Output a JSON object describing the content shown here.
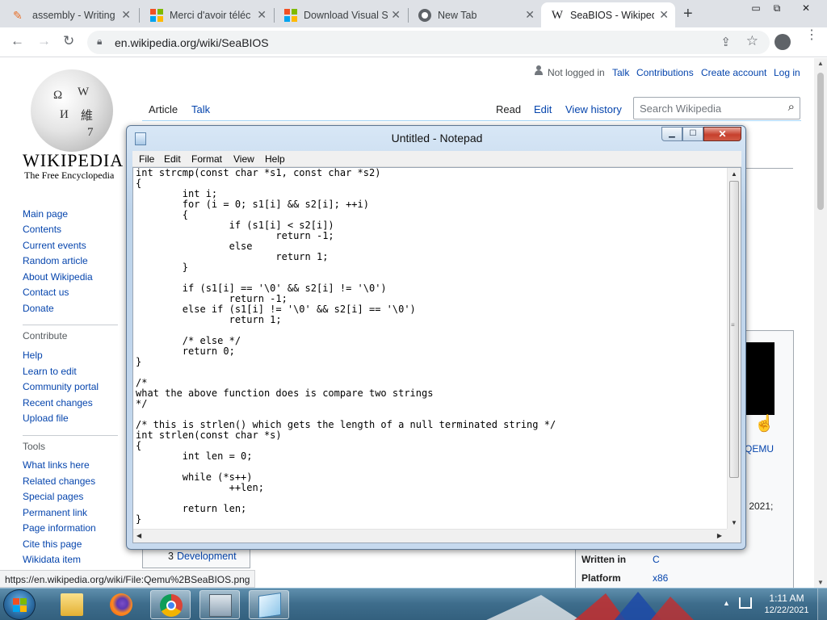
{
  "browser": {
    "tabs": [
      {
        "title": "assembly - Writing",
        "icon": "pen-icon"
      },
      {
        "title": "Merci d'avoir téléc",
        "icon": "microsoft-icon"
      },
      {
        "title": "Download Visual S",
        "icon": "microsoft-icon"
      },
      {
        "title": "New Tab",
        "icon": "chrome-icon"
      },
      {
        "title": "SeaBIOS - Wikiped",
        "icon": "wikipedia-icon",
        "active": true
      }
    ],
    "url": "en.wikipedia.org/wiki/SeaBIOS",
    "status_url": "https://en.wikipedia.org/wiki/File:Qemu%2BSeaBIOS.png"
  },
  "wiki": {
    "wordmark": "Wikipedia",
    "tagline": "The Free Encyclopedia",
    "personal": {
      "not_logged_in": "Not logged in",
      "talk": "Talk",
      "contributions": "Contributions",
      "create_account": "Create account",
      "log_in": "Log in"
    },
    "tabs": {
      "article": "Article",
      "talk": "Talk",
      "read": "Read",
      "edit": "Edit",
      "view_history": "View history"
    },
    "search_placeholder": "Search Wikipedia",
    "nav": {
      "main": [
        "Main page",
        "Contents",
        "Current events",
        "Random article",
        "About Wikipedia",
        "Contact us",
        "Donate"
      ],
      "contribute_heading": "Contribute",
      "contribute": [
        "Help",
        "Learn to edit",
        "Community portal",
        "Recent changes",
        "Upload file"
      ],
      "tools_heading": "Tools",
      "tools": [
        "What links here",
        "Related changes",
        "Special pages",
        "Permanent link",
        "Page information",
        "Cite this page",
        "Wikidata item"
      ]
    },
    "infobox": {
      "caption_fragment": "QEMU",
      "date_fragment": "r 2021;",
      "rows": [
        {
          "key": "Written in",
          "value": "C"
        },
        {
          "key": "Platform",
          "value": "x86"
        }
      ]
    },
    "toc": {
      "number": "3",
      "label": "Development"
    }
  },
  "notepad": {
    "title": "Untitled - Notepad",
    "menu": [
      "File",
      "Edit",
      "Format",
      "View",
      "Help"
    ],
    "content": "int strcmp(const char *s1, const char *s2)\n{\n\tint i;\n\tfor (i = 0; s1[i] && s2[i]; ++i)\n\t{\n\t\tif (s1[i] < s2[i])\n\t\t\treturn -1;\n\t\telse\n\t\t\treturn 1;\n\t}\n\n\tif (s1[i] == '\\0' && s2[i] != '\\0')\n\t\treturn -1;\n\telse if (s1[i] != '\\0' && s2[i] == '\\0')\n\t\treturn 1;\n\n\t/* else */\n\treturn 0;\n}\n\n/*\nwhat the above function does is compare two strings\n*/\n\n/* this is strlen() which gets the length of a null terminated string */\nint strlen(const char *s)\n{\n\tint len = 0;\n\n\twhile (*s++)\n\t\t++len;\n\n\treturn len;\n}"
  },
  "taskbar": {
    "time": "1:11 AM",
    "date": "12/22/2021",
    "apps": [
      "windows-explorer-icon",
      "firefox-icon",
      "chrome-icon",
      "resource-monitor-icon",
      "notepad-icon"
    ]
  }
}
